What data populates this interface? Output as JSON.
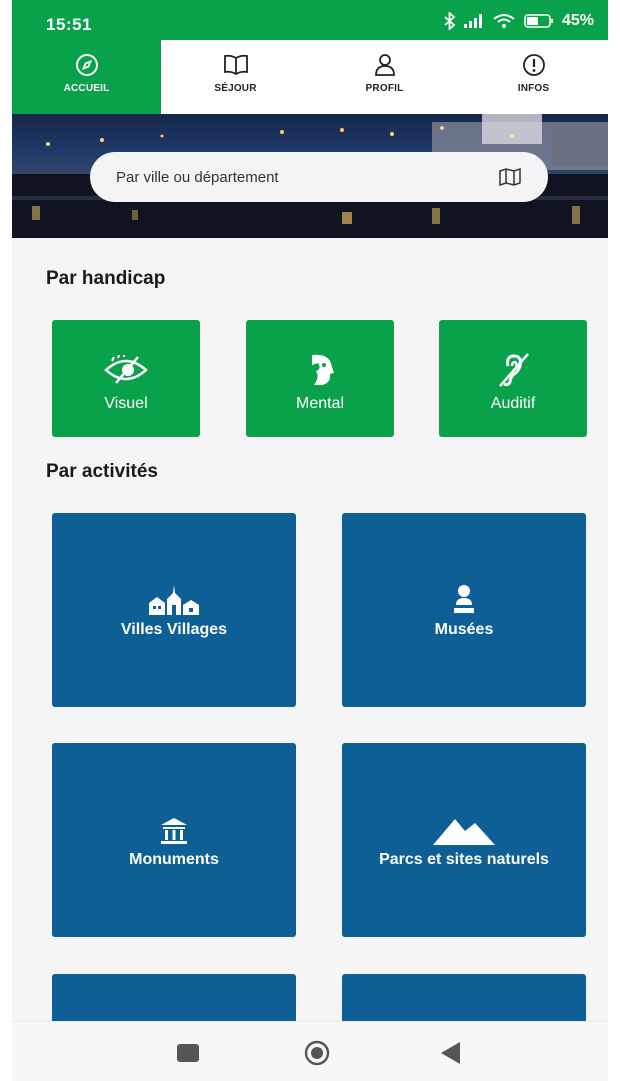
{
  "status_bar": {
    "time": "15:51",
    "battery": "45%",
    "icons": [
      "bluetooth-icon",
      "signal-icon",
      "wifi-icon",
      "battery-icon"
    ]
  },
  "tabs": [
    {
      "label": "ACCUEIL",
      "icon": "compass-icon",
      "active": true
    },
    {
      "label": "SÉJOUR",
      "icon": "book-icon",
      "active": false
    },
    {
      "label": "PROFIL",
      "icon": "user-icon",
      "active": false
    },
    {
      "label": "INFOS",
      "icon": "info-icon",
      "active": false
    }
  ],
  "search": {
    "placeholder": "Par ville ou département",
    "icon": "map-icon"
  },
  "handicap": {
    "title": "Par handicap",
    "items": [
      {
        "label": "Visuel",
        "icon": "eye-icon"
      },
      {
        "label": "Mental",
        "icon": "face-icon"
      },
      {
        "label": "Auditif",
        "icon": "ear-icon"
      }
    ]
  },
  "activities": {
    "title": "Par activités",
    "items": [
      {
        "label": "Villes Villages",
        "icon": "village-icon"
      },
      {
        "label": "Musées",
        "icon": "bust-icon"
      },
      {
        "label": "Monuments",
        "icon": "monument-icon"
      },
      {
        "label": "Parcs et sites naturels",
        "icon": "mountain-icon"
      }
    ]
  },
  "colors": {
    "brand_green": "#0aa14b",
    "tile_blue": "#0d5f96",
    "background": "#f5f5f5"
  }
}
